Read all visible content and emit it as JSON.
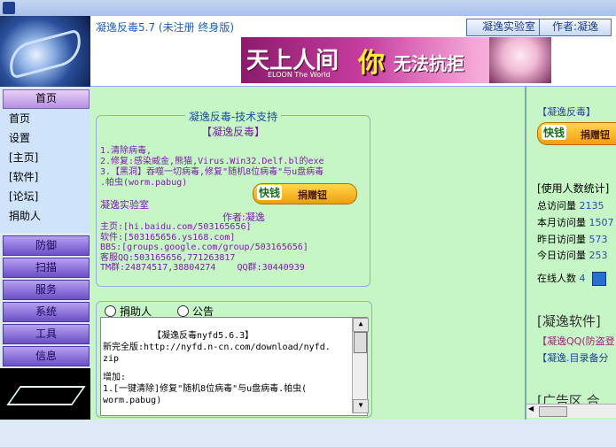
{
  "header": {
    "title": "凝逸反毒5.7  (未注册 终身版)",
    "lab_button": "凝逸实验室",
    "author_button": "作者:凝逸"
  },
  "banner": {
    "text1": "天上人间",
    "text2": "你",
    "text3": "无法抗拒",
    "sub": "ELOON The World"
  },
  "sidebar": {
    "home_tab": "首页",
    "links": [
      "首页",
      "设置",
      "[主页]",
      "[软件]",
      "[论坛]",
      "捐助人"
    ],
    "categories": [
      "防御",
      "扫描",
      "服务",
      "系统",
      "工具",
      "信息"
    ]
  },
  "support": {
    "title": "凝逸反毒-技术支持",
    "subtitle": "【凝逸反毒】",
    "line1": "1.清除病毒,",
    "line2": "2.修复:感染威金,熊猫,Virus.Win32.Delf.bl的exe",
    "line3": "3.【黑洞】吞噬一切病毒,修复\"随机8位病毒\"与u盘病毒",
    "line4": ".帕虫(worm.pabug)",
    "lab": "凝逸实验室",
    "author": "作者:凝逸",
    "home": "主页:[hi.baidu.com/503165656]",
    "soft": "软件:[503165656.ys168.com]",
    "bbs": "BBS:[groups.google.com/group/503165656]",
    "qq": "客服QQ:503165656,771263817",
    "tm": "TM群:24874517,38804274",
    "qqgroup": "QQ群:30440939"
  },
  "donate": {
    "quick": "快钱",
    "label": "捐赠钮"
  },
  "tabs": {
    "donors": "捐助人",
    "notice": "公告"
  },
  "notice": {
    "line1": "【凝逸反毒nyfd5.6.3】",
    "line2": "新完全版:http://nyfd.n-cn.com/download/nyfd.",
    "line3": "zip",
    "line4": "增加:",
    "line5": "1.[一键清除]修复\"随机8位病毒\"与u盘病毒.帕虫(",
    "line6": "worm.pabug)"
  },
  "right": {
    "heading": "【凝逸反毒】",
    "stats_heading": "[使用人数统计]",
    "total_label": "总访问量",
    "total": "2135",
    "month_label": "本月访问量",
    "month": "1507",
    "yesterday_label": "昨日访问量",
    "yesterday": "573",
    "today_label": "今日访问量",
    "today": "253",
    "online_label": "在线人数",
    "online": "4",
    "soft_heading": "[凝逸软件]",
    "qq_link": "【凝逸QQ(防盗登",
    "dir_link": "【凝逸.目录备分",
    "ad_heading": "[广告区 合"
  }
}
